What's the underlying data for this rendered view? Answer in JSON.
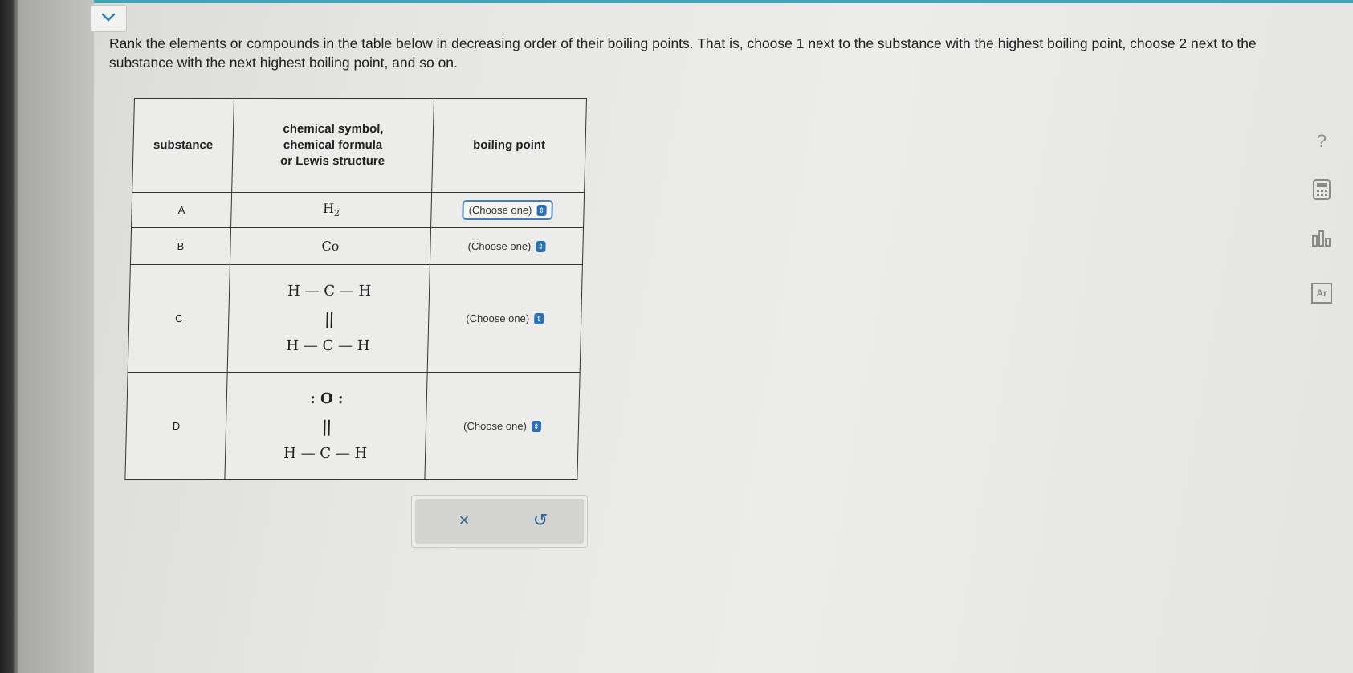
{
  "instructions": "Rank the elements or compounds in the table below in decreasing order of their boiling points. That is, choose 1 next to the substance with the highest boiling point, choose 2 next to the substance with the next highest boiling point, and so on.",
  "table": {
    "headers": {
      "substance": "substance",
      "formula_line1": "chemical symbol,",
      "formula_line2": "chemical formula",
      "formula_line3": "or Lewis structure",
      "boiling_point": "boiling point"
    },
    "rows": [
      {
        "letter": "A",
        "formula": "H",
        "subscript": "2",
        "select": "(Choose one)"
      },
      {
        "letter": "B",
        "formula": "Co",
        "select": "(Choose one)"
      },
      {
        "letter": "C",
        "lewis_top": "H — C — H",
        "lewis_bond": "||",
        "lewis_bottom": "H — C — H",
        "select": "(Choose one)"
      },
      {
        "letter": "D",
        "lewis_top": ": O :",
        "lewis_bond": "||",
        "lewis_bottom": "H — C — H",
        "select": "(Choose one)"
      }
    ]
  },
  "actions": {
    "clear": "×",
    "undo": "↺"
  },
  "tools": {
    "help": "?",
    "calculator": "calculator-icon",
    "chart": "chart-icon",
    "periodic": "Ar"
  },
  "colors": {
    "accent": "#3fa7b1",
    "link": "#2d6fb5"
  }
}
